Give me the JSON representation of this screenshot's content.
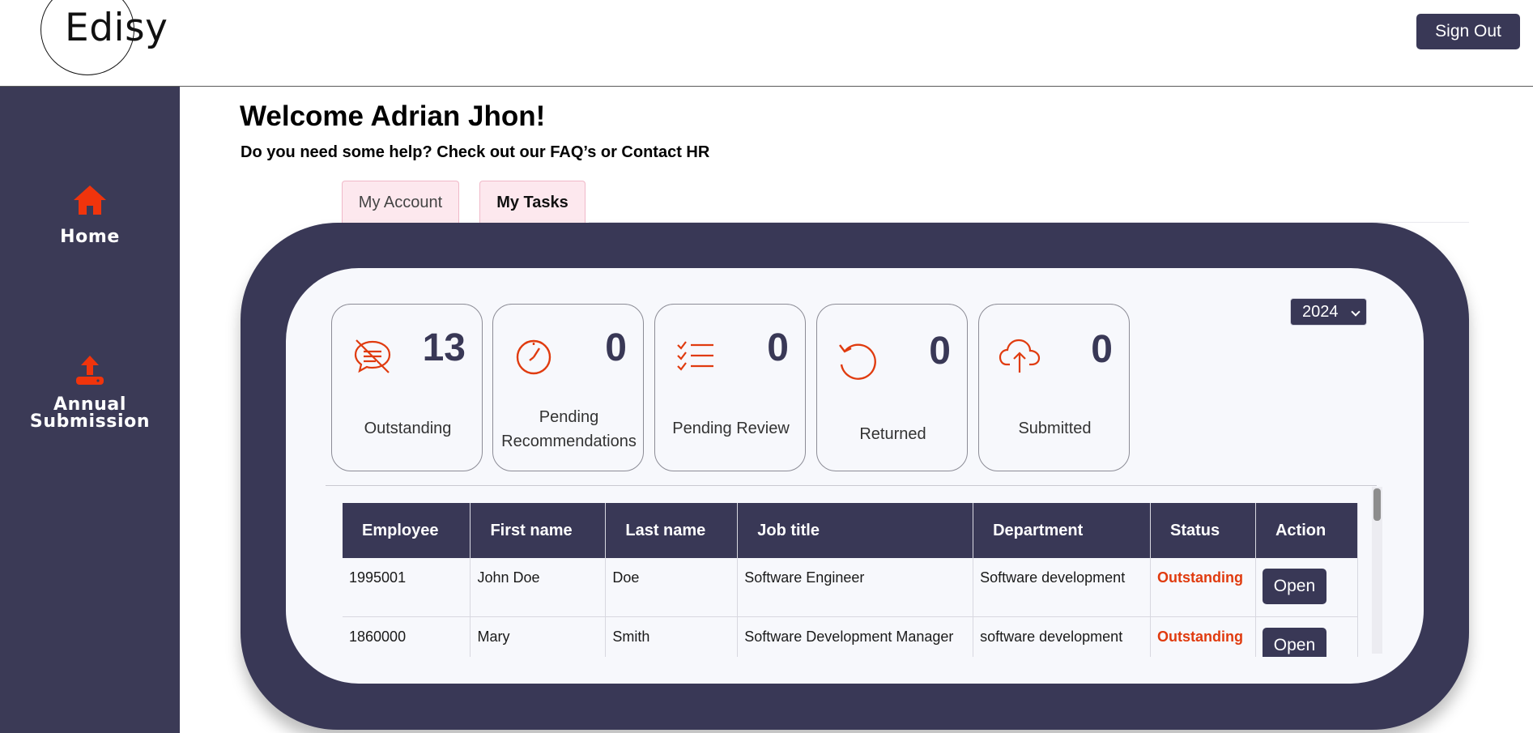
{
  "header": {
    "logo_text": "Edisy",
    "sign_out_label": "Sign Out"
  },
  "sidebar": {
    "items": [
      {
        "label": "Home",
        "icon": "home-icon"
      },
      {
        "label_line1": "Annual",
        "label_line2": "Submission",
        "icon": "upload-icon"
      }
    ]
  },
  "main": {
    "welcome": "Welcome Adrian Jhon!",
    "help": "Do you need some help? Check out our FAQ’s or Contact HR",
    "tabs": [
      {
        "label": "My Account",
        "active": false
      },
      {
        "label": "My Tasks",
        "active": true
      }
    ]
  },
  "dashboard": {
    "year": "2024",
    "cards": [
      {
        "count": "13",
        "label": "Outstanding",
        "icon": "chat-muted-icon"
      },
      {
        "count": "0",
        "label_line1": "Pending",
        "label_line2": "Recommendations",
        "icon": "clock-icon"
      },
      {
        "count": "0",
        "label": "Pending Review",
        "icon": "checklist-icon"
      },
      {
        "count": "0",
        "label": "Returned",
        "icon": "undo-icon"
      },
      {
        "count": "0",
        "label": "Submitted",
        "icon": "cloud-upload-icon"
      }
    ],
    "table": {
      "columns": [
        "Employee",
        "First name",
        "Last name",
        "Job title",
        "Department",
        "Status",
        "Action"
      ],
      "rows": [
        {
          "employee": "1995001",
          "first": "John Doe",
          "last": "Doe",
          "job": "Software Engineer",
          "dept": "Software development",
          "status": "Outstanding",
          "action": "Open"
        },
        {
          "employee": "1860000",
          "first": "Mary",
          "last": "Smith",
          "job": "Software Development Manager",
          "dept": "software development",
          "status": "Outstanding",
          "action": "Open"
        }
      ]
    }
  },
  "colors": {
    "navy": "#393856",
    "accent_orange": "#e03b0f",
    "tab_pink": "#fde8ee"
  }
}
